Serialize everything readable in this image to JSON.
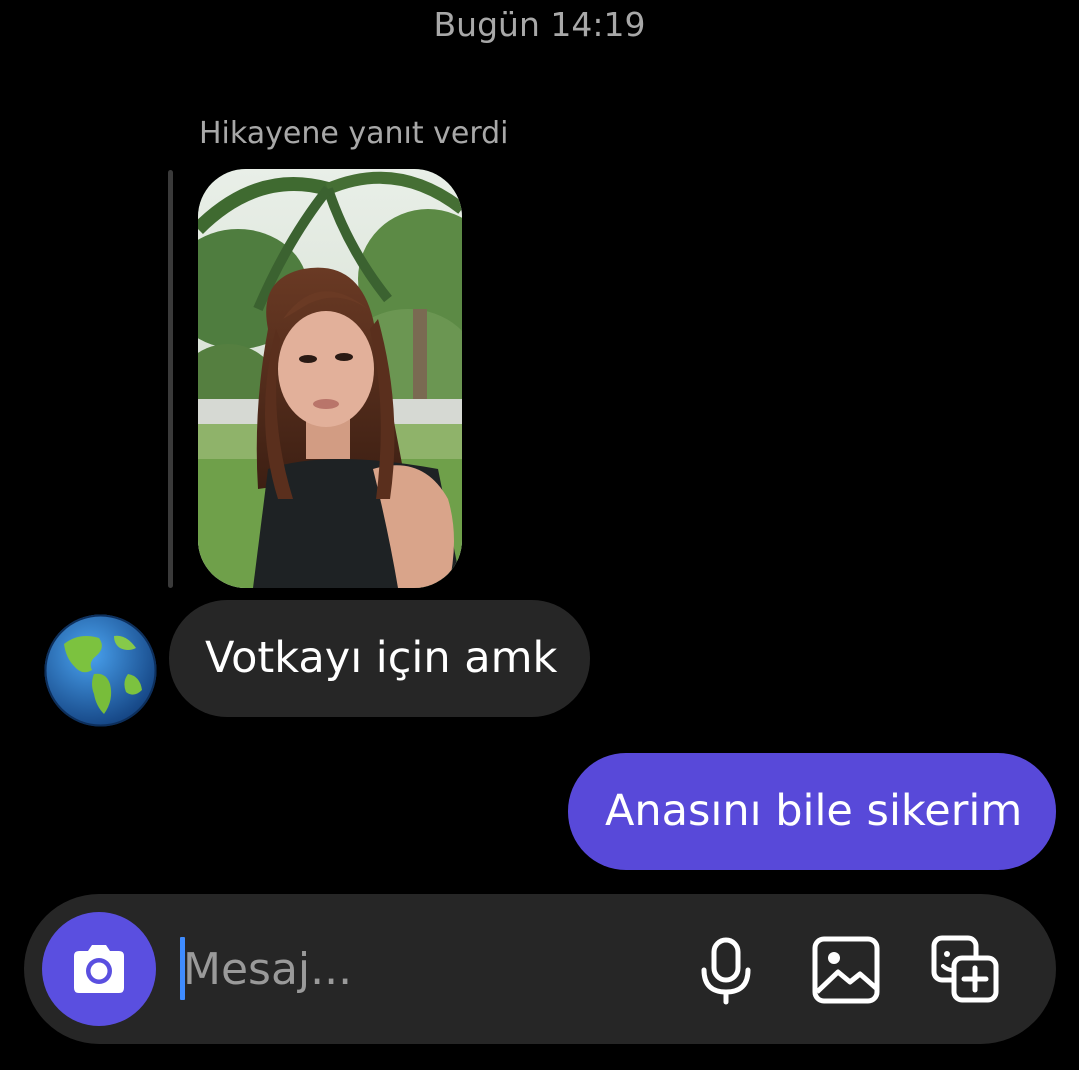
{
  "conversation": {
    "timestamp": "Bugün 14:19",
    "story_reply": {
      "caption": "Hikayene yanıt verdi"
    },
    "messages": [
      {
        "direction": "incoming",
        "text": "Votkayı için amk"
      },
      {
        "direction": "outgoing",
        "text": "Anasını bile sikerim"
      }
    ]
  },
  "composer": {
    "placeholder": "Mesaj...",
    "icons": [
      "camera-icon",
      "microphone-icon",
      "gallery-icon",
      "sticker-add-icon"
    ]
  },
  "colors": {
    "background": "#000000",
    "incoming_bubble": "#262626",
    "outgoing_bubble": "#5849d9",
    "camera_button": "#5a4fe0",
    "caret": "#3f8cff",
    "secondary_text": "#a8a8a8"
  }
}
